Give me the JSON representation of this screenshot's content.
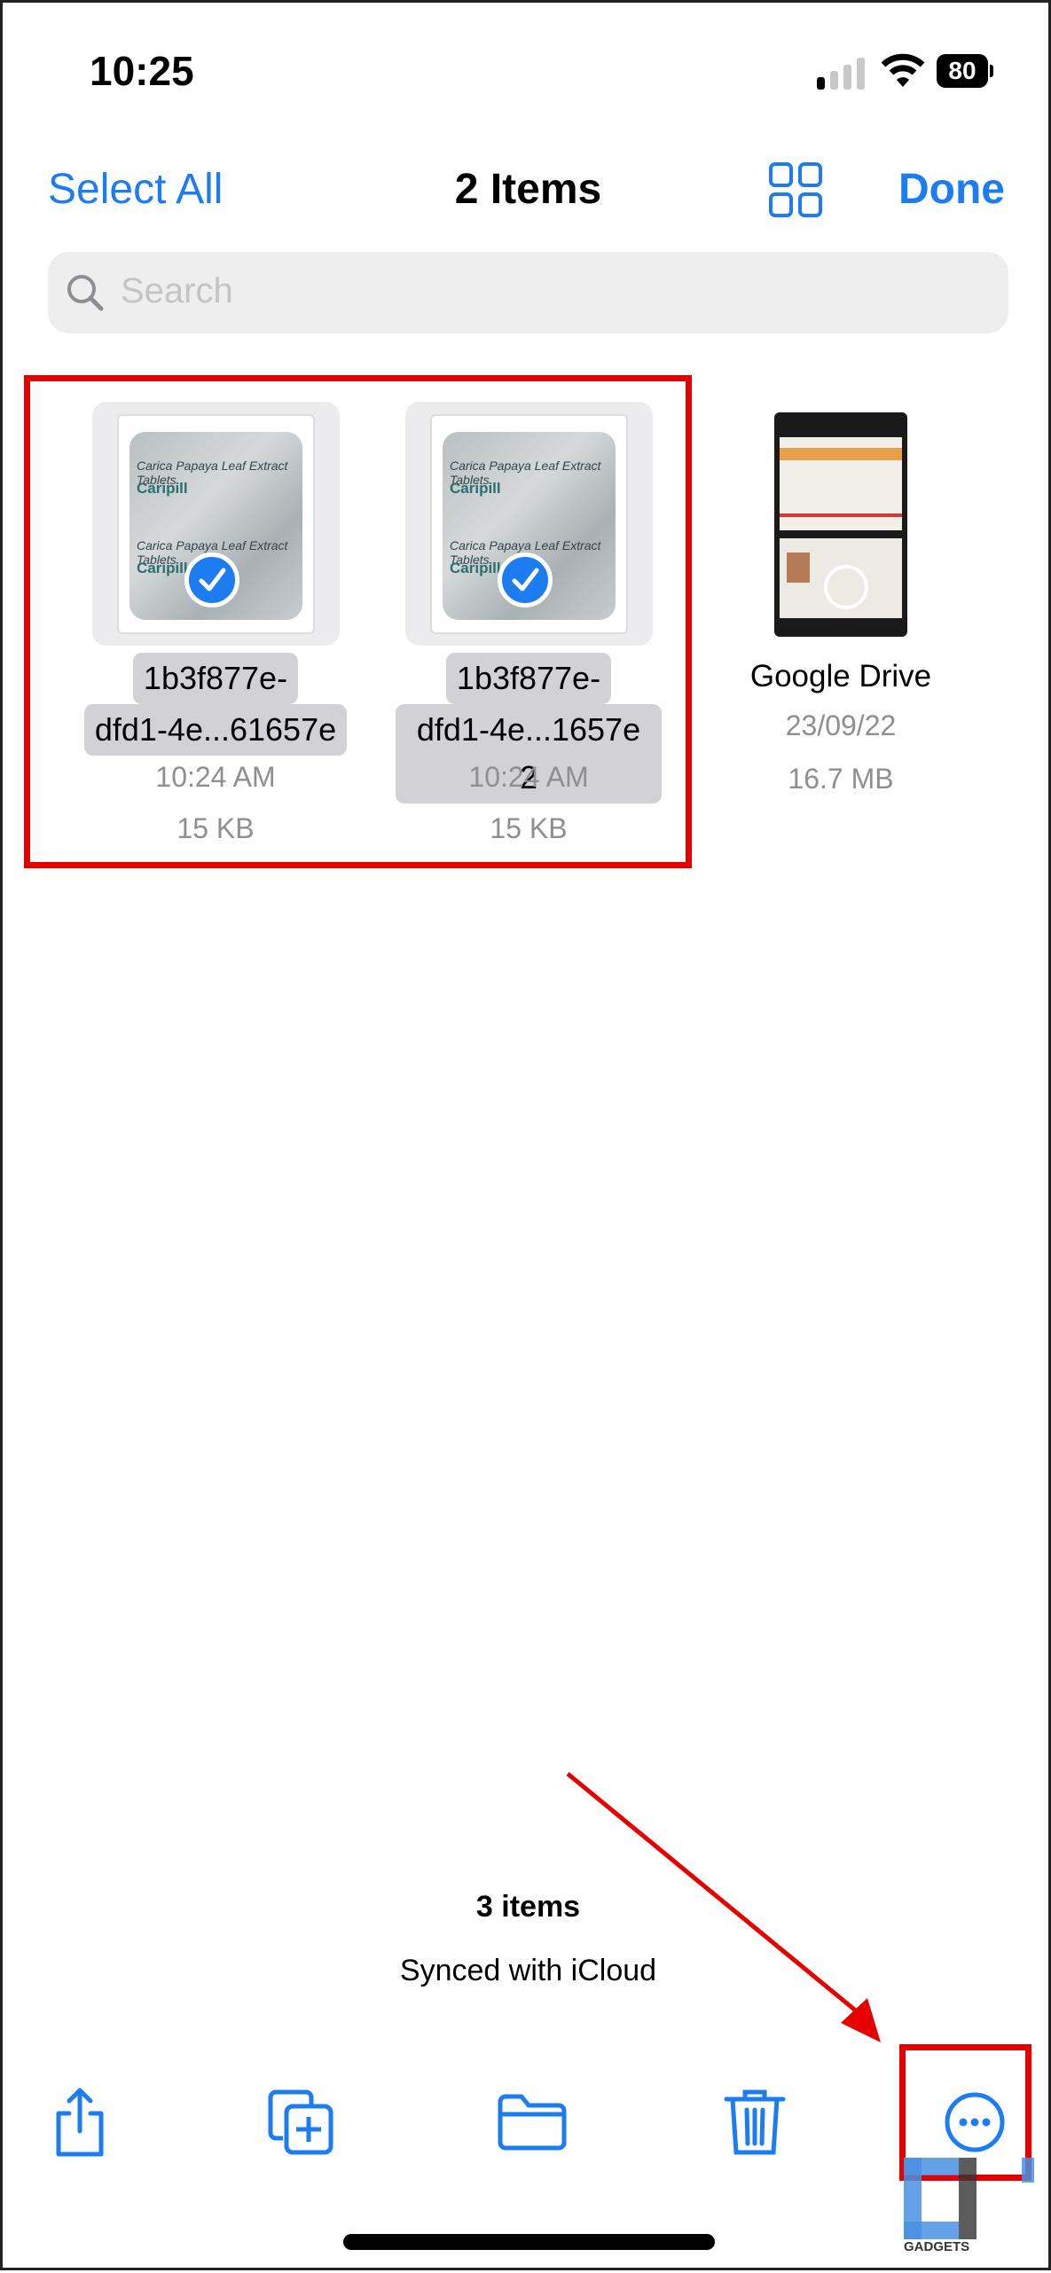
{
  "status_bar": {
    "time": "10:25",
    "battery": "80"
  },
  "nav": {
    "select_all": "Select All",
    "title": "2 Items",
    "done": "Done",
    "view_icon": "grid-view-icon"
  },
  "search": {
    "placeholder": "Search"
  },
  "files": [
    {
      "name_line1": "1b3f877e-",
      "name_line2": "dfd1-4e...61657e",
      "time": "10:24 AM",
      "size": "15 KB",
      "selected": true,
      "thumb_text": "Carica Papaya Leaf Extract Tablets",
      "thumb_brand": "Caripill"
    },
    {
      "name_line1": "1b3f877e-",
      "name_line2": "dfd1-4e...1657e 2",
      "time": "10:24 AM",
      "size": "15 KB",
      "selected": true,
      "thumb_text": "Carica Papaya Leaf Extract Tablets",
      "thumb_brand": "Caripill"
    },
    {
      "name_line1": "Google Drive",
      "date": "23/09/22",
      "size": "16.7 MB",
      "selected": false
    }
  ],
  "footer": {
    "count": "3 items",
    "sync": "Synced with iCloud"
  },
  "toolbar": [
    "share-icon",
    "duplicate-icon",
    "move-folder-icon",
    "trash-icon",
    "more-icon"
  ],
  "watermark": {
    "text": "GADGETS"
  },
  "colors": {
    "accent": "#1c7cf0",
    "annotation": "#e60000"
  }
}
